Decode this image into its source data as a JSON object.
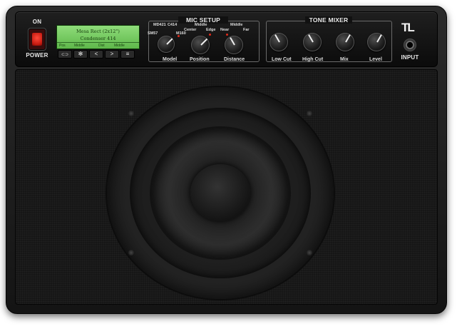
{
  "power": {
    "on_label": "ON",
    "label": "POWER",
    "state": "on"
  },
  "display": {
    "line1": "Mesa Rect (2x12\")",
    "line2": "Condenser 414",
    "row_left_tag": "Pos",
    "row_left_value": "Middle",
    "row_right_tag": "Dist",
    "row_right_value": "Middle"
  },
  "nav_buttons": [
    {
      "name": "link-icon",
      "glyph": "⊂⊃"
    },
    {
      "name": "settings-icon",
      "glyph": "✻"
    },
    {
      "name": "prev-icon",
      "glyph": "<"
    },
    {
      "name": "next-icon",
      "glyph": ">"
    },
    {
      "name": "menu-icon",
      "glyph": "≡"
    }
  ],
  "mic_setup": {
    "title": "MIC SETUP",
    "model_label": "Model",
    "position_label": "Position",
    "distance_label": "Distance",
    "model_options": [
      "SM57",
      "MD421",
      "C414",
      "M160"
    ],
    "position_options": [
      "Center",
      "Middle",
      "Edge"
    ],
    "distance_options": [
      "Near",
      "Middle",
      "Far"
    ]
  },
  "tone_mixer": {
    "title": "TONE MIXER",
    "low_cut_label": "Low Cut",
    "high_cut_label": "High Cut",
    "mix_label": "Mix",
    "level_label": "Level"
  },
  "logo": "TL",
  "input_label": "INPUT",
  "colors": {
    "power_red": "#e02a1b",
    "lcd_green": "#7fd06a"
  }
}
